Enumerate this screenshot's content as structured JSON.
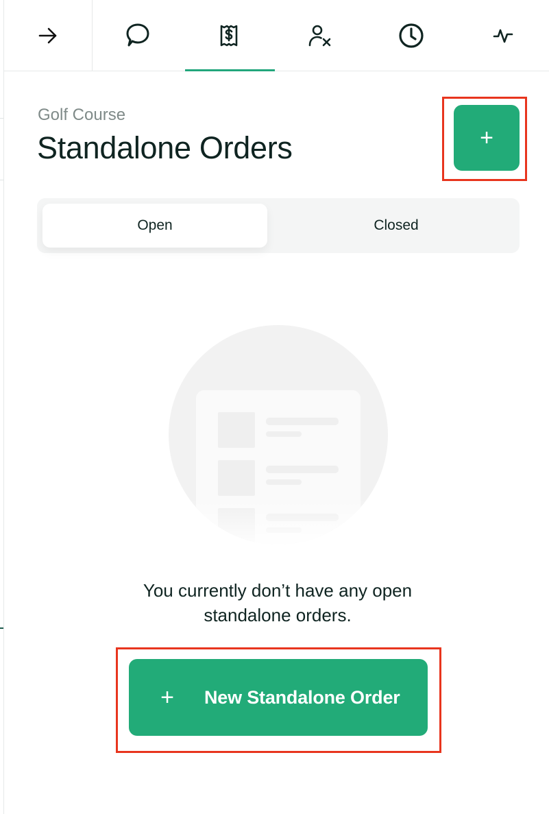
{
  "nav": {
    "back_icon": "arrow-right-icon",
    "tabs": [
      {
        "icon": "chat-bubble-icon",
        "active": false
      },
      {
        "icon": "receipt-dollar-icon",
        "active": true
      },
      {
        "icon": "user-remove-icon",
        "active": false
      },
      {
        "icon": "clock-icon",
        "active": false
      },
      {
        "icon": "activity-pulse-icon",
        "active": false
      }
    ],
    "accent_color": "#22a67c"
  },
  "header": {
    "subtitle": "Golf Course",
    "title": "Standalone Orders",
    "add_button_label": "+"
  },
  "segment": {
    "options": [
      "Open",
      "Closed"
    ],
    "selected": "Open"
  },
  "empty_state": {
    "illustration_icon": "empty-list-illustration",
    "message": "You currently don’t have any open standalone orders.",
    "cta_plus": "+",
    "cta_label": "New Standalone Order"
  },
  "colors": {
    "primary": "#22ab78",
    "highlight": "#e8351e",
    "text": "#0f2421",
    "muted": "#7f8a88"
  }
}
